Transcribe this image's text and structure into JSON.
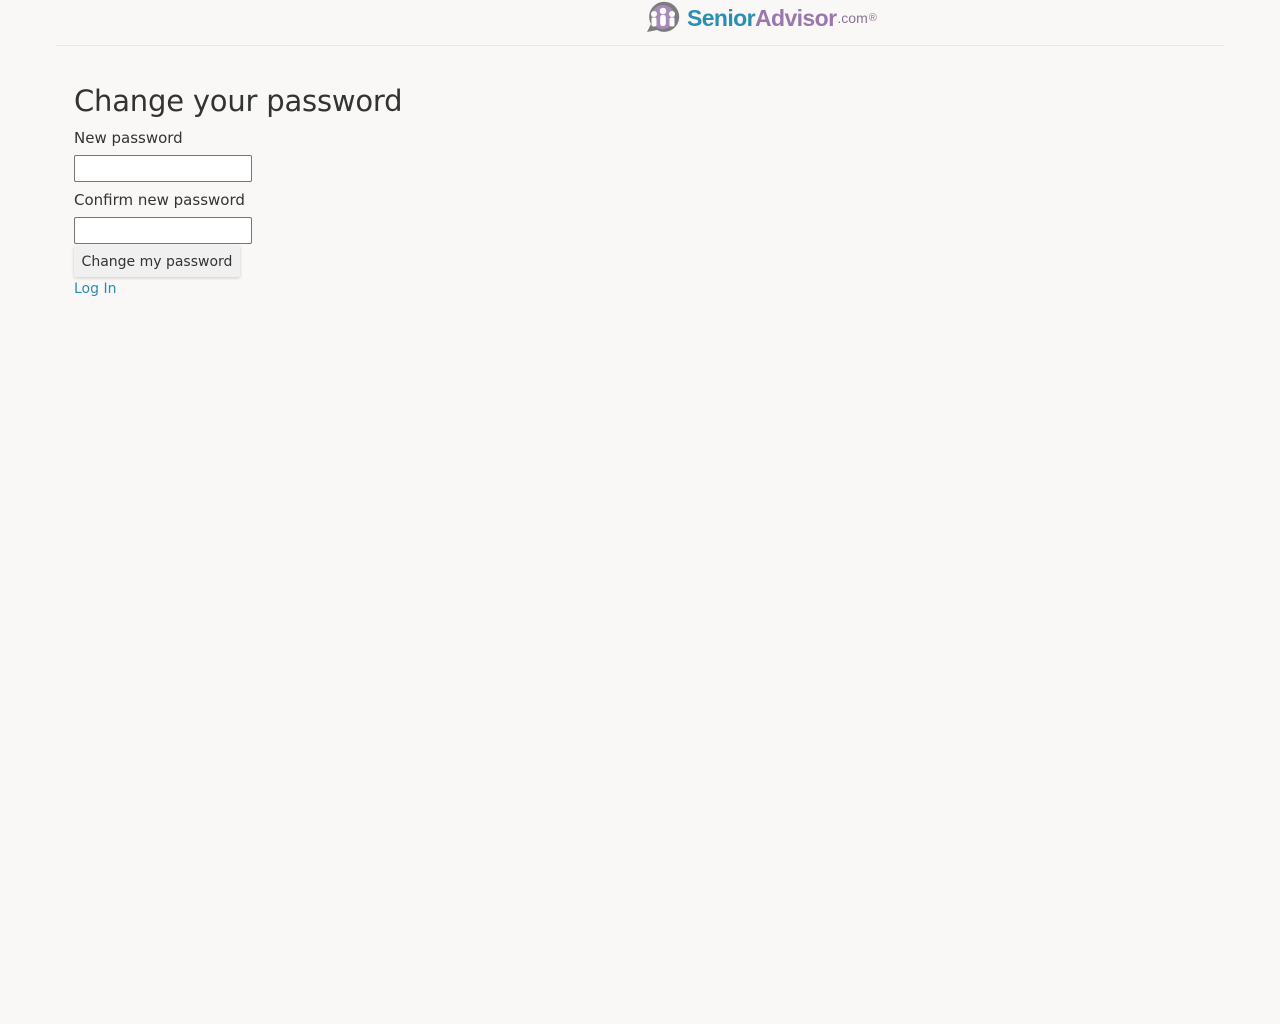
{
  "header": {
    "logo": {
      "icon": "people-speech-bubble-logo-icon",
      "word_senior": "Senior",
      "word_advisor": "Advisor",
      "suffix": ".com",
      "registered": "®",
      "colors": {
        "senior": "#2b8fb4",
        "advisor": "#9a78ad"
      }
    }
  },
  "form": {
    "title": "Change your password",
    "new_password": {
      "label": "New password",
      "value": ""
    },
    "confirm_password": {
      "label": "Confirm new password",
      "value": ""
    },
    "submit_label": "Change my password",
    "login_link": "Log In"
  },
  "colors": {
    "background": "#f9f8f6",
    "link": "#2b8fb4",
    "text": "#333333"
  }
}
